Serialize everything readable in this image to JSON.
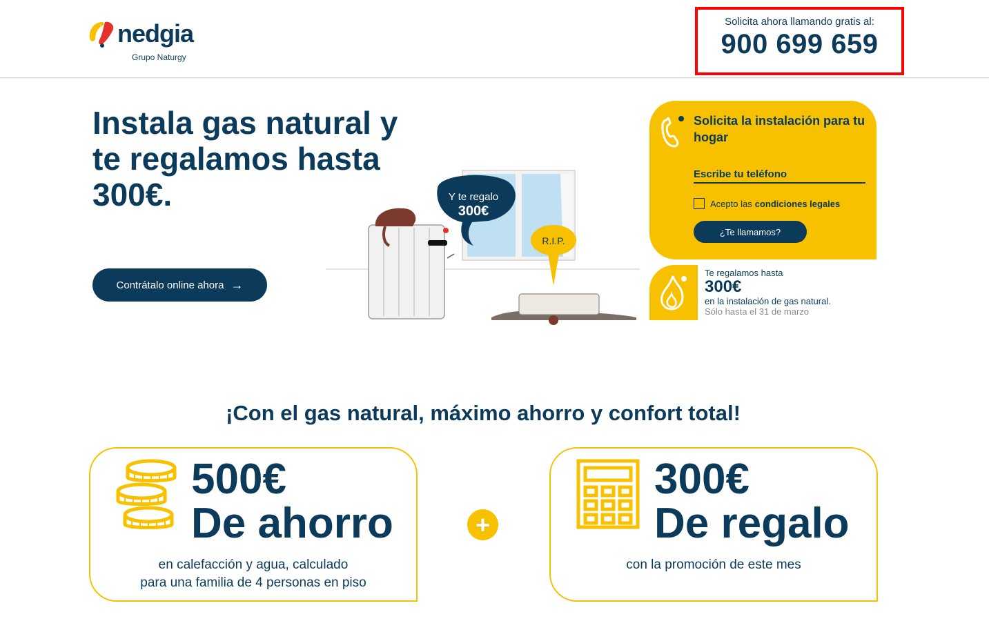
{
  "header": {
    "logo_word": "nedgia",
    "logo_sub": "Grupo Naturgy",
    "call_label": "Solicita ahora llamando gratis al:",
    "call_number": "900 699 659"
  },
  "hero": {
    "title": "Instala gas natural y te regalamos hasta 300€.",
    "cta_label": "Contrátalo online ahora",
    "bubble_1_line1": "Y te regalo",
    "bubble_1_line2": "300€",
    "bubble_2": "R.I.P."
  },
  "form": {
    "title": "Solicita la instalación para tu hogar",
    "phone_placeholder": "Escribe tu teléfono",
    "accept_prefix": "Acepto las",
    "accept_link": "condiciones legales",
    "submit_label": "¿Te llamamos?"
  },
  "promo": {
    "line1": "Te regalamos hasta",
    "amount": "300€",
    "line2": "en la instalación de gas natural.",
    "line3": "Sólo hasta el 31 de marzo"
  },
  "benefits": {
    "title": "¡Con el gas natural, máximo ahorro y confort total!",
    "card1": {
      "amount": "500€",
      "label": "De ahorro",
      "desc_line1": "en calefacción y agua, calculado",
      "desc_line2": "para una familia de 4 personas en piso"
    },
    "plus_symbol": "+",
    "card2": {
      "amount": "300€",
      "label": "De regalo",
      "desc_line1": "con la promoción de este mes"
    }
  },
  "colors": {
    "navy": "#0b3a5b",
    "yellow": "#f7c100",
    "highlight_red": "#ff0000"
  }
}
